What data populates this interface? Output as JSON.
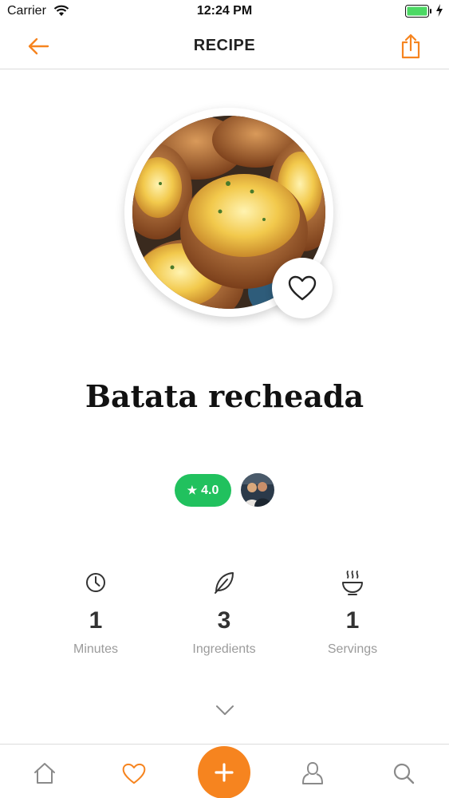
{
  "status_bar": {
    "carrier": "Carrier",
    "time": "12:24 PM"
  },
  "nav": {
    "title": "RECIPE",
    "back_icon": "arrow-left-icon",
    "share_icon": "share-icon"
  },
  "recipe": {
    "title": "Batata recheada",
    "rating": "4.0",
    "favorite_icon": "heart-outline-icon"
  },
  "stats": [
    {
      "icon": "clock-icon",
      "value": "1",
      "label": "Minutes"
    },
    {
      "icon": "leaf-icon",
      "value": "3",
      "label": "Ingredients"
    },
    {
      "icon": "bowl-icon",
      "value": "1",
      "label": "Servings"
    }
  ],
  "tab_bar": {
    "items": [
      "home-icon",
      "heart-icon",
      "plus-icon",
      "user-icon",
      "search-icon"
    ]
  },
  "colors": {
    "accent": "#f6841f",
    "rating_green": "#21c15e",
    "label_gray": "#9b9b9b",
    "battery_green": "#4cd964"
  }
}
